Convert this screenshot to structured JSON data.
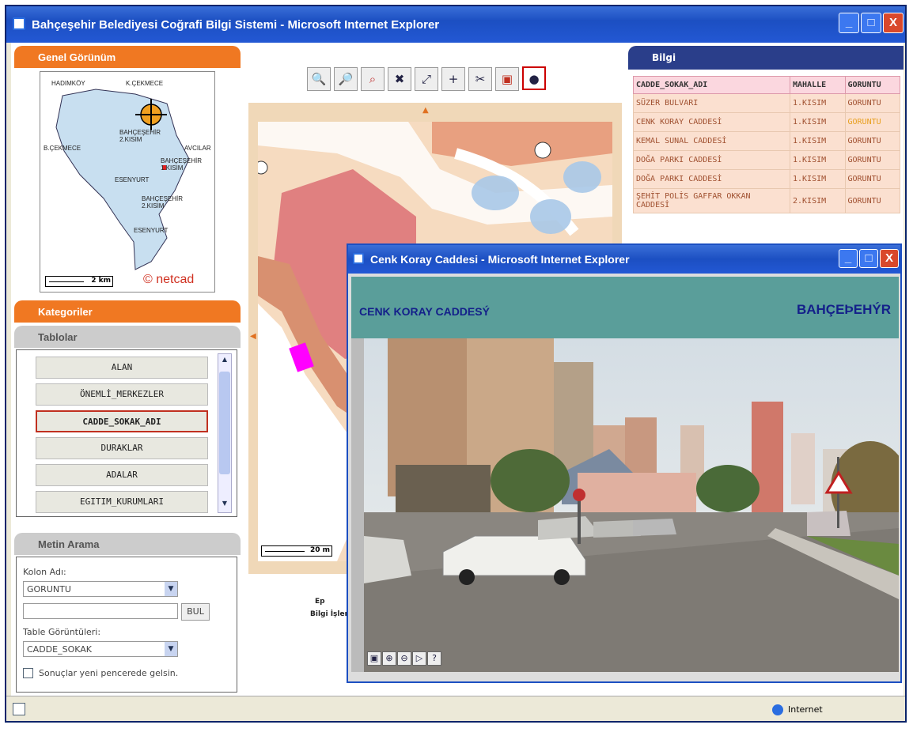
{
  "window": {
    "title": "Bahçeşehir Belediyesi Coğrafi Bilgi Sistemi - Microsoft Internet Explorer",
    "minimize": "_",
    "maximize": "□",
    "close": "X"
  },
  "left": {
    "overview_header": "Genel Görünüm",
    "overview_labels": [
      "HADIMKÖY",
      "K.ÇEKMECE",
      "BAHÇEŞEHİR 2.KISIM",
      "B.ÇEKMECE",
      "AVCILAR",
      "BAHÇEŞEHİR 1.KISIM",
      "ESENYURT",
      "BAHÇEŞEHİR 2.KISIM",
      "ESENYURT"
    ],
    "scale": "2 km",
    "brand": "netcad",
    "categories_header": "Kategoriler",
    "tables_header": "Tablolar",
    "tables": [
      "ALAN",
      "ÖNEMLİ_MERKEZLER",
      "CADDE_SOKAK_ADI",
      "DURAKLAR",
      "ADALAR",
      "EGITIM_KURUMLARI"
    ],
    "selected_table": "CADDE_SOKAK_ADI",
    "search_header": "Metin Arama",
    "column_label": "Kolon Adı:",
    "column_value": "GORUNTU",
    "search_text": "",
    "search_button": "BUL",
    "table_views_label": "Table Görüntüleri:",
    "table_view_value": "CADDE_SOKAK",
    "new_window_label": "Sonuçlar yeni pencerede gelsin."
  },
  "map": {
    "tools": [
      "zoom-in-icon",
      "zoom-out-icon",
      "zoom-area-icon",
      "full-extent-icon",
      "fit-icon",
      "pan-icon",
      "measure-icon",
      "print-icon",
      "info-icon"
    ],
    "scale": "20 m",
    "partial_text_1": "Ep",
    "partial_text_2": "Bilgi İşlem"
  },
  "info": {
    "header": "Bilgi",
    "columns": [
      "CADDE_SOKAK_ADI",
      "MAHALLE",
      "GORUNTU"
    ],
    "rows": [
      [
        "SÜZER BULVARI",
        "1.KISIM",
        "GORUNTU"
      ],
      [
        "CENK KORAY CADDESİ",
        "1.KISIM",
        "GORUNTU"
      ],
      [
        "KEMAL SUNAL CADDESİ",
        "1.KISIM",
        "GORUNTU"
      ],
      [
        "DOĞA PARKI CADDESİ",
        "1.KISIM",
        "GORUNTU"
      ],
      [
        "DOĞA PARKI CADDESİ",
        "1.KISIM",
        "GORUNTU"
      ],
      [
        "ŞEHİT POLİS GAFFAR OKKAN CADDESİ",
        "2.KISIM",
        "GORUNTU"
      ]
    ],
    "highlight_row": 1
  },
  "popup": {
    "title": "Cenk Koray Caddesi - Microsoft Internet Explorer",
    "street": "CENK KORAY CADDESÝ",
    "district": "BAHÇEÞEHÝR",
    "controls": [
      "photo-icon",
      "zoom-in-icon",
      "zoom-out-icon",
      "play-icon",
      "help-icon"
    ]
  },
  "status": {
    "zone": "Internet"
  },
  "colors": {
    "orange": "#f07822",
    "navy": "#2a3e8a",
    "teal": "#5a9e9a",
    "titlebar": "#1c4fc2"
  }
}
